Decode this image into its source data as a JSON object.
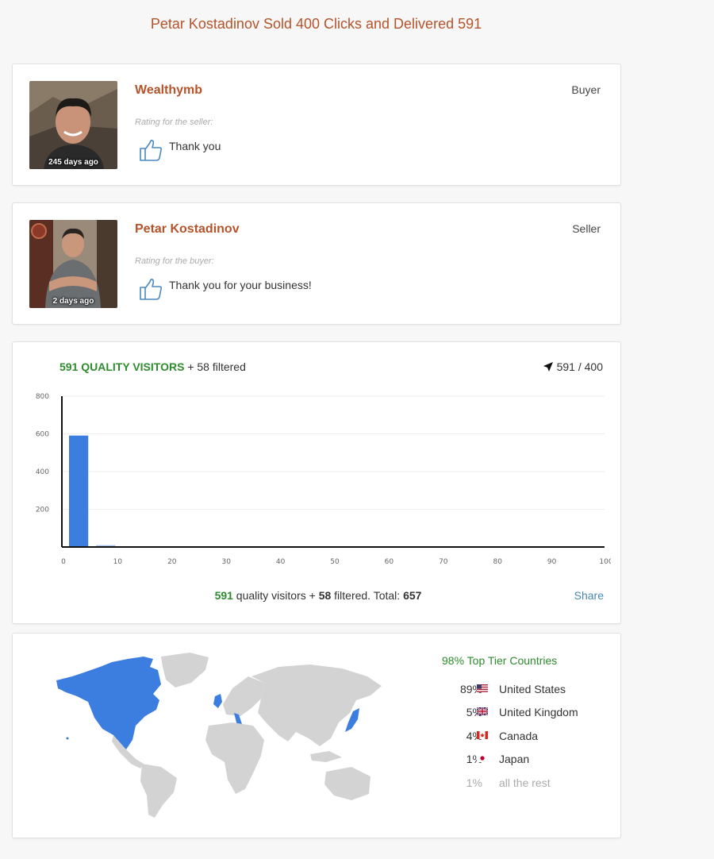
{
  "headline": "Petar Kostadinov Sold 400 Clicks and Delivered 591",
  "reviews": [
    {
      "name": "Wealthymb",
      "role": "Buyer",
      "ago": "245 days ago",
      "label": "Rating for the seller:",
      "text": "Thank you"
    },
    {
      "name": "Petar Kostadinov",
      "role": "Seller",
      "ago": "2 days ago",
      "label": "Rating for the buyer:",
      "text": "Thank you for your business!"
    }
  ],
  "stats": {
    "quality": "591 QUALITY VISITORS",
    "filtered": "+ 58 filtered",
    "ratio": "591 / 400",
    "footer": {
      "quality_num": "591",
      "quality_txt": " quality visitors + ",
      "filtered_num": "58",
      "filtered_txt": " filtered. Total: ",
      "total": "657"
    },
    "share": "Share"
  },
  "chart_data": {
    "type": "bar",
    "x": [
      0,
      5
    ],
    "values": [
      591,
      10
    ],
    "bin_width": 5,
    "xlim": [
      0,
      100
    ],
    "ylim": [
      0,
      800
    ],
    "xticks": [
      0,
      10,
      20,
      30,
      40,
      50,
      60,
      70,
      80,
      90,
      100
    ],
    "yticks": [
      200,
      400,
      600,
      800
    ],
    "bar_color": "#3c7de0",
    "grid": true
  },
  "geo": {
    "tier": "98% Top Tier Countries",
    "countries": [
      {
        "pct": "89%",
        "name": "United States",
        "flag": "us-flag"
      },
      {
        "pct": "5%",
        "name": "United Kingdom",
        "flag": "uk-flag"
      },
      {
        "pct": "4%",
        "name": "Canada",
        "flag": "canada-flag"
      },
      {
        "pct": "1%",
        "name": "Japan",
        "flag": "japan-flag"
      }
    ],
    "rest": {
      "pct": "1%",
      "name": "all the rest"
    },
    "highlight_color": "#3c7de0",
    "land_color": "#d3d3d3"
  }
}
